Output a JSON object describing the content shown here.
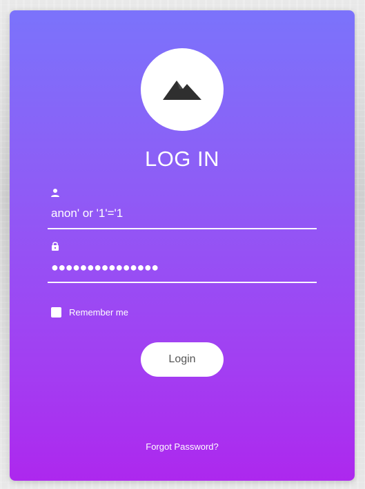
{
  "form": {
    "title": "LOG IN",
    "username": {
      "value": "anon' or '1'='1",
      "icon": "user-icon"
    },
    "password": {
      "masked_value": "●●●●●●●●●●●●●●●",
      "icon": "lock-icon"
    },
    "remember_label": "Remember me",
    "login_label": "Login",
    "forgot_label": "Forgot Password?"
  },
  "colors": {
    "gradient_top": "#7b73fb",
    "gradient_bottom": "#ad28ee",
    "text": "#ffffff",
    "button_text": "#555555"
  }
}
